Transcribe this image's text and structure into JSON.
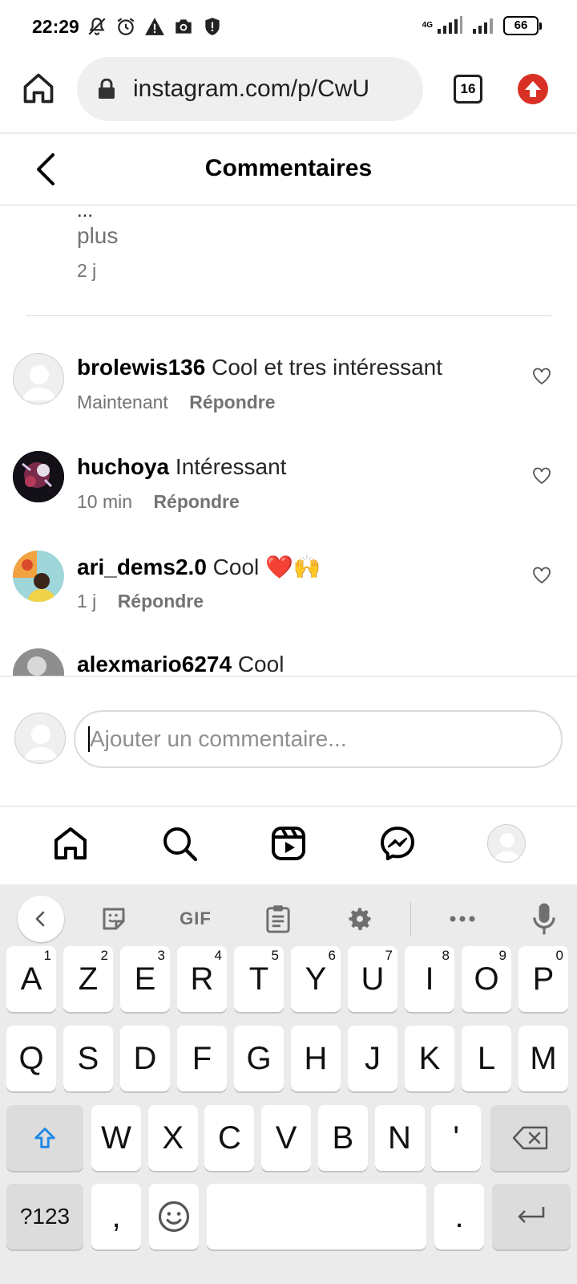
{
  "status_bar": {
    "time": "22:29",
    "network": "4G",
    "battery": "66",
    "icons": [
      "mute-icon",
      "alarm-icon",
      "warning-icon",
      "camera-icon",
      "shield-icon",
      "signal-icon",
      "signal-icon"
    ]
  },
  "browser": {
    "url": "instagram.com/p/CwU",
    "tab_count": "16"
  },
  "header": {
    "title": "Commentaires"
  },
  "caption": {
    "ellipsis": "...",
    "more": "plus",
    "time": "2 j"
  },
  "comments": [
    {
      "username": "brolewis136",
      "text": "Cool et tres intéressant",
      "time": "Maintenant",
      "reply": "Répondre"
    },
    {
      "username": "huchoya",
      "text": "Intéressant",
      "time": "10 min",
      "reply": "Répondre"
    },
    {
      "username": "ari_dems2.0",
      "text": "Cool ❤️🙌",
      "time": "1 j",
      "reply": "Répondre"
    },
    {
      "username": "alexmario6274",
      "text": "Cool",
      "time": "",
      "reply": ""
    }
  ],
  "add_comment": {
    "placeholder": "Ajouter un commentaire..."
  },
  "keyboard": {
    "toolbar": {
      "gif": "GIF"
    },
    "row1": [
      {
        "k": "A",
        "h": "1"
      },
      {
        "k": "Z",
        "h": "2"
      },
      {
        "k": "E",
        "h": "3"
      },
      {
        "k": "R",
        "h": "4"
      },
      {
        "k": "T",
        "h": "5"
      },
      {
        "k": "Y",
        "h": "6"
      },
      {
        "k": "U",
        "h": "7"
      },
      {
        "k": "I",
        "h": "8"
      },
      {
        "k": "O",
        "h": "9"
      },
      {
        "k": "P",
        "h": "0"
      }
    ],
    "row2": [
      "Q",
      "S",
      "D",
      "F",
      "G",
      "H",
      "J",
      "K",
      "L",
      "M"
    ],
    "row3": [
      "W",
      "X",
      "C",
      "V",
      "B",
      "N",
      "'"
    ],
    "symbols": "?123",
    "comma": ",",
    "period": "."
  }
}
